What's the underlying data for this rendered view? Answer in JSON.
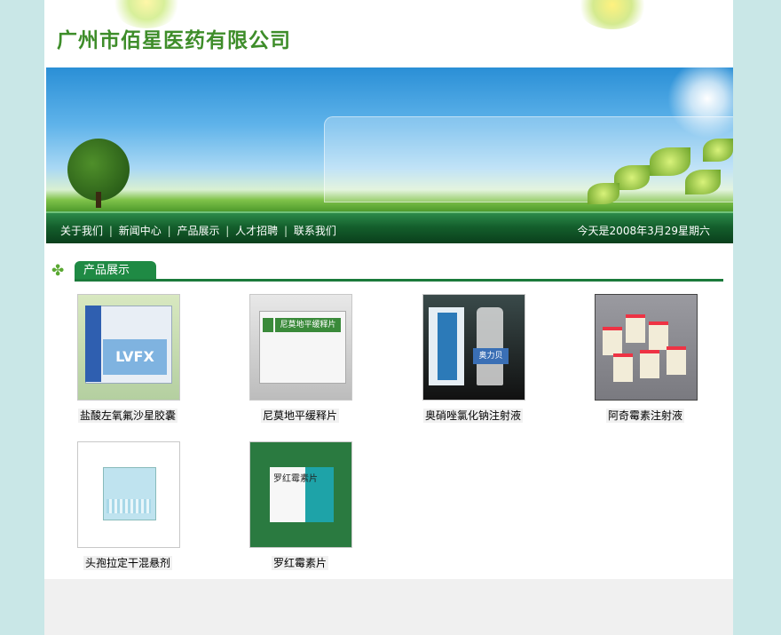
{
  "header": {
    "company_name": "广州市佰星医药有限公司"
  },
  "nav": {
    "items": [
      "关于我们",
      "新闻中心",
      "产品展示",
      "人才招聘",
      "联系我们"
    ],
    "separator": "|",
    "date_text": "今天是2008年3月29星期六"
  },
  "section": {
    "title": "产品展示",
    "icon": "clover-icon"
  },
  "products": [
    {
      "name": "盐酸左氧氟沙星胶囊",
      "box_text": "LVFX"
    },
    {
      "name": "尼莫地平缓释片",
      "box_text": "尼莫地平缓释片"
    },
    {
      "name": "奥硝唑氯化钠注射液",
      "box_text": "奥力贝"
    },
    {
      "name": "阿奇霉素注射液",
      "box_text": ""
    },
    {
      "name": "头孢拉定干混悬剂",
      "box_text": ""
    },
    {
      "name": "罗红霉素片",
      "box_text": "罗红霉素片"
    }
  ],
  "colors": {
    "page_bg": "#c9e7e7",
    "brand_green": "#3e8d2a",
    "nav_green": "#145f2c",
    "tab_green": "#1f8a44"
  }
}
